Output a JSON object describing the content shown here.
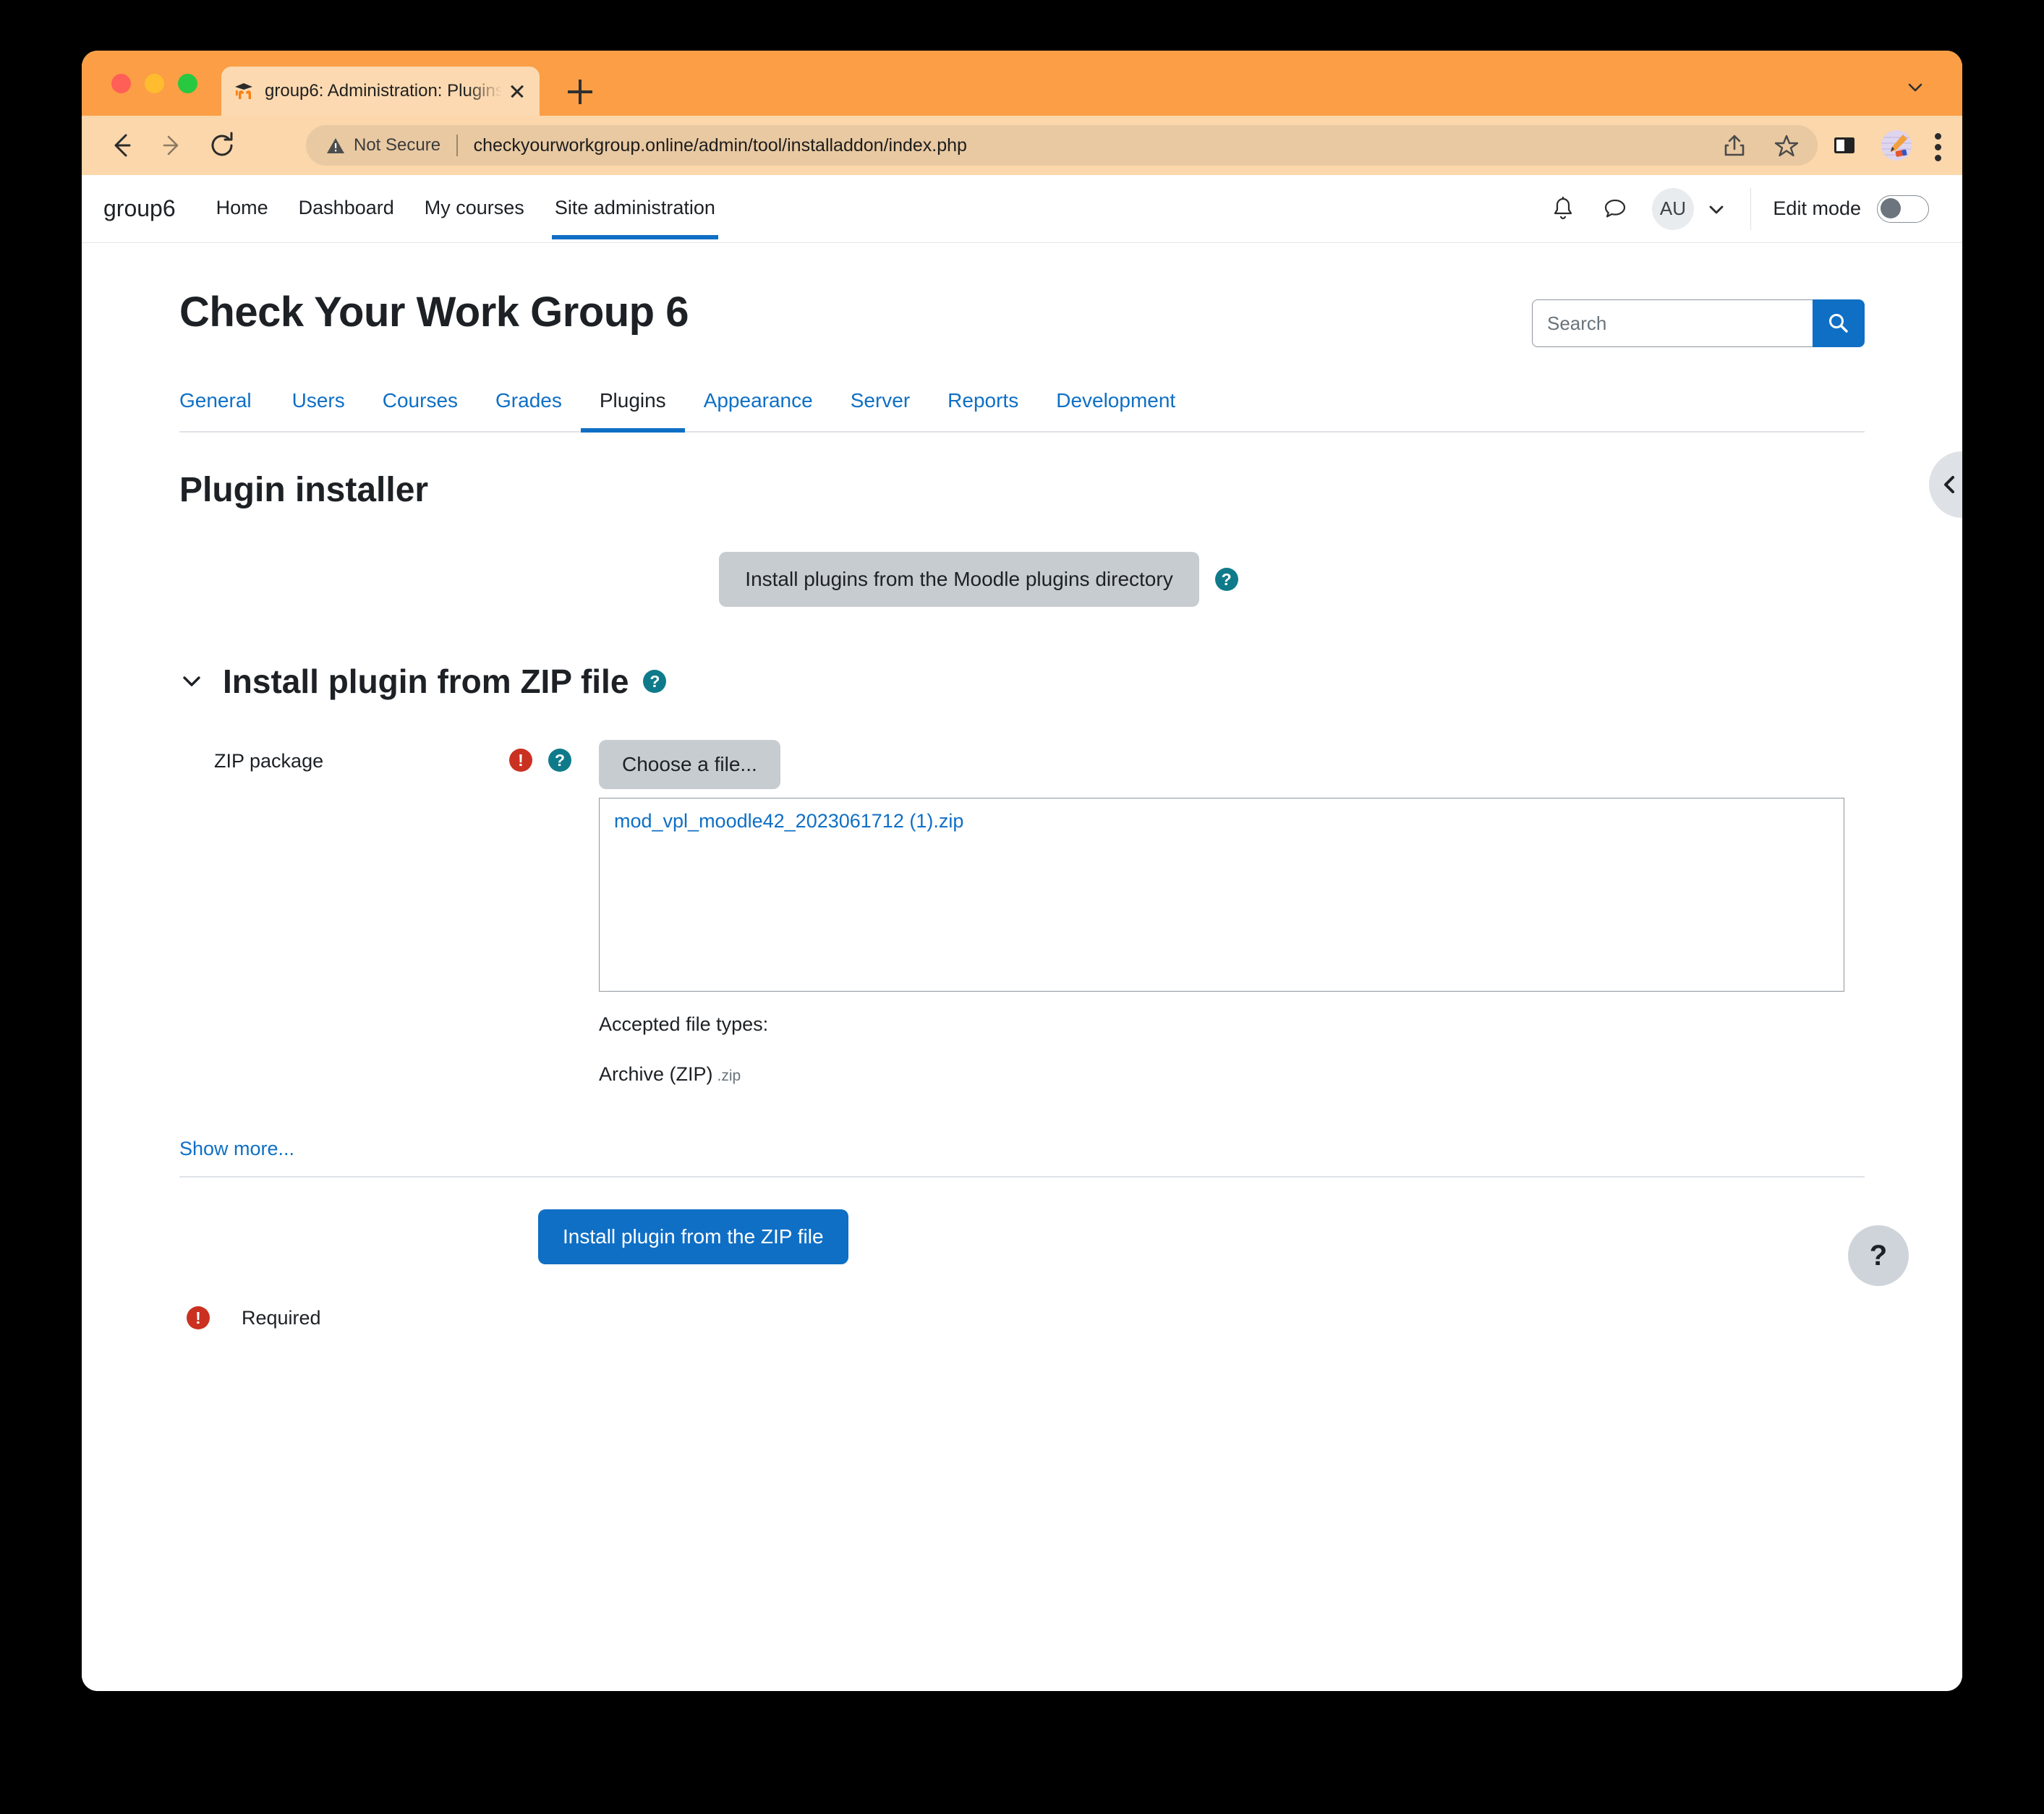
{
  "browser": {
    "tab": {
      "title": "group6: Administration: Plugins",
      "favicon": "moodle-logo-icon",
      "close_icon": "close-icon"
    },
    "new_tab_icon": "plus-icon",
    "window_chevron_icon": "chevron-down-icon",
    "nav": {
      "back_icon": "back-arrow-icon",
      "forward_icon": "forward-arrow-icon",
      "reload_icon": "reload-icon"
    },
    "omnibox": {
      "security_icon": "warning-triangle-icon",
      "security_label": "Not Secure",
      "url": "checkyourworkgroup.online/admin/tool/installaddon/index.php",
      "url_domain": "checkyourworkgroup.online",
      "url_path": "/admin/tool/installaddon/index.php",
      "share_icon": "share-icon",
      "bookmark_icon": "star-icon"
    },
    "toolbar": {
      "sidepanel_icon": "side-panel-icon",
      "profile_icon": "profile-avatar-icon",
      "menu_icon": "kebab-menu-icon"
    }
  },
  "moodle": {
    "brand": "group6",
    "nav_links": [
      {
        "label": "Home",
        "active": false
      },
      {
        "label": "Dashboard",
        "active": false
      },
      {
        "label": "My courses",
        "active": false
      },
      {
        "label": "Site administration",
        "active": true
      }
    ],
    "nav_right": {
      "notifications_icon": "bell-icon",
      "messages_icon": "chat-bubble-icon",
      "avatar_initials": "AU",
      "avatar_chevron_icon": "chevron-down-icon",
      "edit_mode_label": "Edit mode",
      "edit_mode_on": false
    },
    "drawer_toggle_icon": "chevron-left-icon"
  },
  "page": {
    "title": "Check Your Work Group 6",
    "search": {
      "placeholder": "Search",
      "value": "",
      "button_icon": "search-icon"
    },
    "tabs": [
      {
        "label": "General",
        "active": false
      },
      {
        "label": "Users",
        "active": false
      },
      {
        "label": "Courses",
        "active": false
      },
      {
        "label": "Grades",
        "active": false
      },
      {
        "label": "Plugins",
        "active": true
      },
      {
        "label": "Appearance",
        "active": false
      },
      {
        "label": "Server",
        "active": false
      },
      {
        "label": "Reports",
        "active": false
      },
      {
        "label": "Development",
        "active": false
      }
    ],
    "section_title": "Plugin installer",
    "directory_button": {
      "label": "Install plugins from the Moodle plugins directory",
      "help_icon": "help-circle-icon",
      "help_glyph": "?"
    },
    "zip_section": {
      "chevron_icon": "chevron-down-icon",
      "title": "Install plugin from ZIP file",
      "help_icon": "help-circle-icon",
      "help_glyph": "?",
      "field_label": "ZIP package",
      "required_icon": "required-exclamation-icon",
      "required_glyph": "!",
      "field_help_icon": "help-circle-icon",
      "field_help_glyph": "?",
      "choose_file_label": "Choose a file...",
      "dropped_file": "mod_vpl_moodle42_2023061712 (1).zip",
      "accepted_label": "Accepted file types:",
      "accepted_type": "Archive (ZIP)",
      "accepted_extension": ".zip"
    },
    "show_more_label": "Show more...",
    "submit_label": "Install plugin from the ZIP file",
    "required_note": "Required",
    "required_note_icon": "required-exclamation-icon",
    "required_note_glyph": "!",
    "floating_help_label": "?"
  },
  "colors": {
    "accent_blue": "#0f6fc5",
    "help_teal": "#0f7b8a",
    "required_red": "#ca3120",
    "button_gray": "#c7ccd1",
    "browser_orange": "#fb9e46"
  }
}
